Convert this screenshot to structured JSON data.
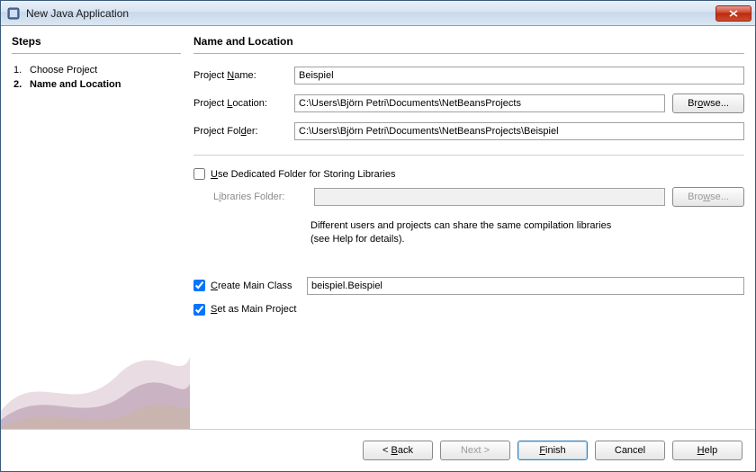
{
  "window": {
    "title": "New Java Application"
  },
  "steps": {
    "heading": "Steps",
    "items": [
      {
        "num": "1.",
        "label": "Choose Project",
        "current": false
      },
      {
        "num": "2.",
        "label": "Name and Location",
        "current": true
      }
    ]
  },
  "main": {
    "heading": "Name and Location",
    "projectName": {
      "label": "Project Name:",
      "value": "Beispiel"
    },
    "projectLocation": {
      "label": "Project Location:",
      "value": "C:\\Users\\Björn Petri\\Documents\\NetBeansProjects",
      "browse": "Browse..."
    },
    "projectFolder": {
      "label": "Project Folder:",
      "value": "C:\\Users\\Björn Petri\\Documents\\NetBeansProjects\\Beispiel"
    },
    "dedicatedFolder": {
      "label": "Use Dedicated Folder for Storing Libraries",
      "checked": false
    },
    "librariesFolder": {
      "label": "Libraries Folder:",
      "value": "",
      "browse": "Browse..."
    },
    "librariesHint": "Different users and projects can share the same compilation libraries (see Help for details).",
    "createMainClass": {
      "label": "Create Main Class",
      "checked": true,
      "value": "beispiel.Beispiel"
    },
    "setMainProject": {
      "label": "Set as Main Project",
      "checked": true
    }
  },
  "buttons": {
    "back": "< Back",
    "next": "Next >",
    "finish": "Finish",
    "cancel": "Cancel",
    "help": "Help"
  }
}
